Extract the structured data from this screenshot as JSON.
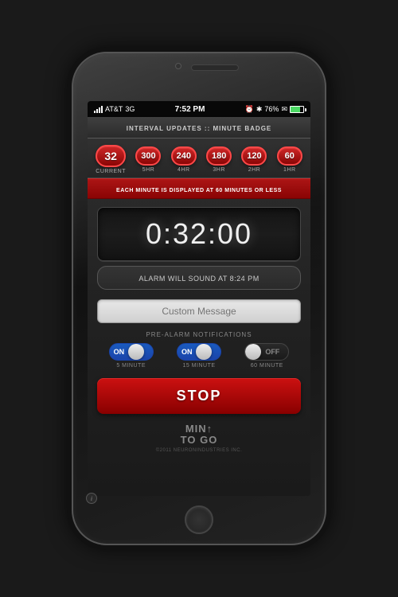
{
  "phone": {
    "status_bar": {
      "carrier": "AT&T",
      "network": "3G",
      "time": "7:52 PM",
      "battery_percent": "76%",
      "battery_fill": 76
    },
    "header": {
      "title": "INTERVAL UPDATES :: MINUTE BADGE"
    },
    "badges": [
      {
        "id": "current",
        "number": "32",
        "label": "CURRENT",
        "large": true
      },
      {
        "id": "5hr",
        "number": "300",
        "label": "5HR",
        "large": false
      },
      {
        "id": "4hr",
        "number": "240",
        "label": "4HR",
        "large": false
      },
      {
        "id": "3hr",
        "number": "180",
        "label": "3HR",
        "large": false
      },
      {
        "id": "2hr",
        "number": "120",
        "label": "2HR",
        "large": false
      },
      {
        "id": "1hr",
        "number": "60",
        "label": "1HR",
        "large": false
      }
    ],
    "warning": {
      "text": "EACH MINUTE IS DISPLAYED AT 60 MINUTES OR LESS"
    },
    "timer": {
      "time": "0:32:00",
      "alarm_label": "ALARM WILL SOUND AT 8:24 PM"
    },
    "custom_message": {
      "placeholder": "Custom Message"
    },
    "pre_alarm": {
      "section_label": "PRE-ALARM NOTIFICATIONS",
      "toggles": [
        {
          "id": "5min",
          "state": "on",
          "label": "5 MINUTE"
        },
        {
          "id": "15min",
          "state": "on",
          "label": "15 MINUTE"
        },
        {
          "id": "60min",
          "state": "off",
          "label": "60 MINUTE"
        }
      ]
    },
    "stop_button": {
      "label": "STOP"
    },
    "logo": {
      "line1": "MIN↑",
      "line2": "TO GO"
    },
    "copyright": "©2011 NEURONINDUSTRIES INC.",
    "info_button": "i"
  }
}
